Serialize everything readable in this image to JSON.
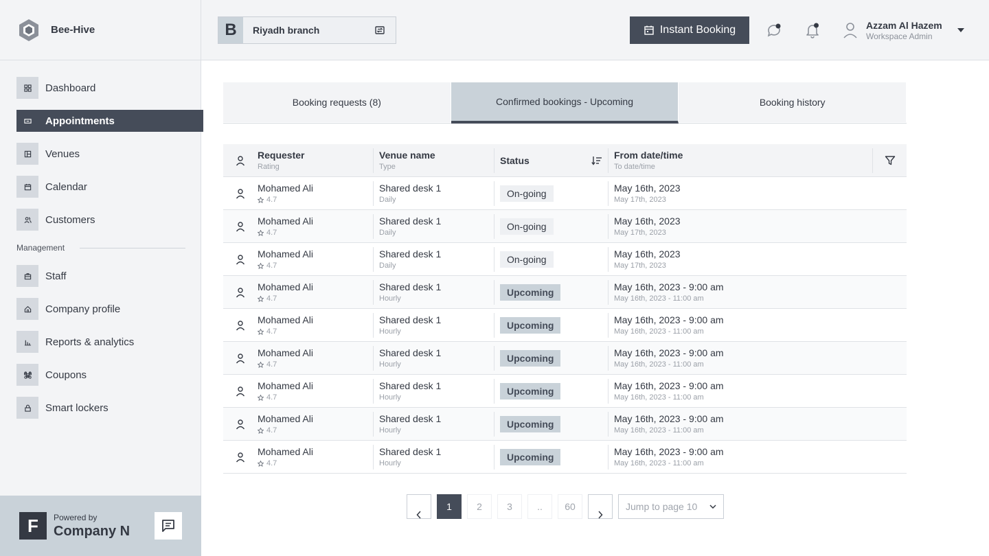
{
  "brand": {
    "name": "Bee-Hive"
  },
  "sidebar": {
    "items": [
      {
        "label": "Dashboard",
        "icon": "grid-icon"
      },
      {
        "label": "Appointments",
        "icon": "ticket-icon",
        "active": true
      },
      {
        "label": "Venues",
        "icon": "building-icon"
      },
      {
        "label": "Calendar",
        "icon": "calendar-icon"
      },
      {
        "label": "Customers",
        "icon": "users-icon"
      }
    ],
    "section_label": "Management",
    "management_items": [
      {
        "label": "Staff",
        "icon": "briefcase-icon"
      },
      {
        "label": "Company profile",
        "icon": "home-icon"
      },
      {
        "label": "Reports & analytics",
        "icon": "bar-chart-icon"
      },
      {
        "label": "Coupons",
        "icon": "command-icon"
      },
      {
        "label": "Smart lockers",
        "icon": "lock-icon"
      }
    ],
    "powered": {
      "by": "Powered by",
      "company": "Company N",
      "logo_letter": "F"
    }
  },
  "header": {
    "branch": {
      "badge": "B",
      "name": "Riyadh branch"
    },
    "instant_booking": "Instant Booking",
    "user": {
      "name": "Azzam Al Hazem",
      "role": "Workspace Admin"
    }
  },
  "tabs": [
    {
      "label": "Booking requests (8)"
    },
    {
      "label": "Confirmed bookings - Upcoming",
      "active": true
    },
    {
      "label": "Booking history"
    }
  ],
  "table": {
    "headers": {
      "requester": "Requester",
      "requester_sub": "Rating",
      "venue": "Venue name",
      "venue_sub": "Type",
      "status": "Status",
      "from": "From date/time",
      "from_sub": "To date/time"
    },
    "rows": [
      {
        "name": "Mohamed Ali",
        "rating": "4.7",
        "venue": "Shared desk 1",
        "type": "Daily",
        "status": "On-going",
        "from": "May 16th, 2023",
        "to": "May 17th, 2023"
      },
      {
        "name": "Mohamed Ali",
        "rating": "4.7",
        "venue": "Shared desk 1",
        "type": "Daily",
        "status": "On-going",
        "from": "May 16th, 2023",
        "to": "May 17th, 2023"
      },
      {
        "name": "Mohamed Ali",
        "rating": "4.7",
        "venue": "Shared desk 1",
        "type": "Daily",
        "status": "On-going",
        "from": "May 16th, 2023",
        "to": "May 17th, 2023"
      },
      {
        "name": "Mohamed Ali",
        "rating": "4.7",
        "venue": "Shared desk 1",
        "type": "Hourly",
        "status": "Upcoming",
        "from": "May 16th, 2023 - 9:00 am",
        "to": "May 16th, 2023 - 11:00 am"
      },
      {
        "name": "Mohamed Ali",
        "rating": "4.7",
        "venue": "Shared desk 1",
        "type": "Hourly",
        "status": "Upcoming",
        "from": "May 16th, 2023 - 9:00 am",
        "to": "May 16th, 2023 - 11:00 am"
      },
      {
        "name": "Mohamed Ali",
        "rating": "4.7",
        "venue": "Shared desk 1",
        "type": "Hourly",
        "status": "Upcoming",
        "from": "May 16th, 2023 - 9:00 am",
        "to": "May 16th, 2023 - 11:00 am"
      },
      {
        "name": "Mohamed Ali",
        "rating": "4.7",
        "venue": "Shared desk 1",
        "type": "Hourly",
        "status": "Upcoming",
        "from": "May 16th, 2023 - 9:00 am",
        "to": "May 16th, 2023 - 11:00 am"
      },
      {
        "name": "Mohamed Ali",
        "rating": "4.7",
        "venue": "Shared desk 1",
        "type": "Hourly",
        "status": "Upcoming",
        "from": "May 16th, 2023 - 9:00 am",
        "to": "May 16th, 2023 - 11:00 am"
      },
      {
        "name": "Mohamed Ali",
        "rating": "4.7",
        "venue": "Shared desk 1",
        "type": "Hourly",
        "status": "Upcoming",
        "from": "May 16th, 2023 - 9:00 am",
        "to": "May 16th, 2023 - 11:00 am"
      }
    ]
  },
  "pagination": {
    "pages": [
      "1",
      "2",
      "3",
      "..",
      "60"
    ],
    "current": "1",
    "jump_label": "Jump to page 10"
  },
  "colors": {
    "accent": "#454c59",
    "surface": "#f3f4f6",
    "highlight": "#c9d2d9"
  }
}
